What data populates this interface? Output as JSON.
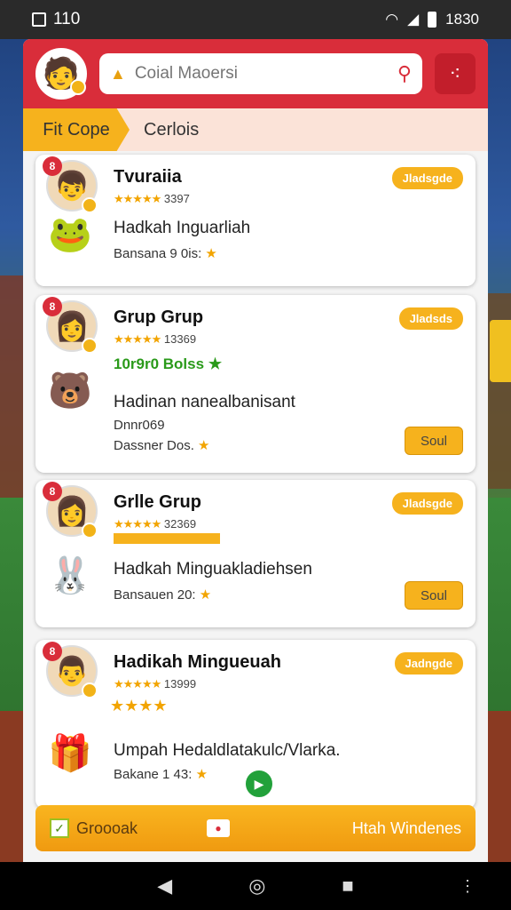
{
  "status_bar": {
    "time": "110",
    "clock": "1830"
  },
  "search": {
    "placeholder": "Coial Maoersi"
  },
  "tabs": {
    "active": "Fit Cope",
    "other": "Cerlois"
  },
  "cards": [
    {
      "number": "8",
      "name": "Tvuraiia",
      "rating_text": "3397",
      "badge": "Jladsgde",
      "line": "Hadkah Inguarliah",
      "sub": "Bansana 9 0is:"
    },
    {
      "number": "8",
      "name": "Grup Grup",
      "rating_text": "13369",
      "badge": "Jladsds",
      "green": "10r9r0 Bolss",
      "line": "Hadinan nanealbanisant",
      "sub1": "Dnnr069",
      "sub2": "Dassner Dos.",
      "button": "Soul"
    },
    {
      "number": "8",
      "name": "Grlle Grup",
      "rating_text": "32369",
      "badge": "Jladsgde",
      "line": "Hadkah Minguakladiehsen",
      "sub": "Bansauen 20:",
      "button": "Soul"
    },
    {
      "number": "8",
      "name": "Hadikah Mingueuah",
      "rating_text": "13999",
      "badge": "Jadngde",
      "line": "Umpah Hedaldlatakulc/Vlarka.",
      "sub": "Bakane 1 43:"
    }
  ],
  "bottom_bar": {
    "left_label": "Groooak",
    "right_label": "Htah Windenes"
  },
  "colors": {
    "brand_red": "#d92d3a",
    "accent_orange": "#f6b21d",
    "green": "#22a13a"
  }
}
